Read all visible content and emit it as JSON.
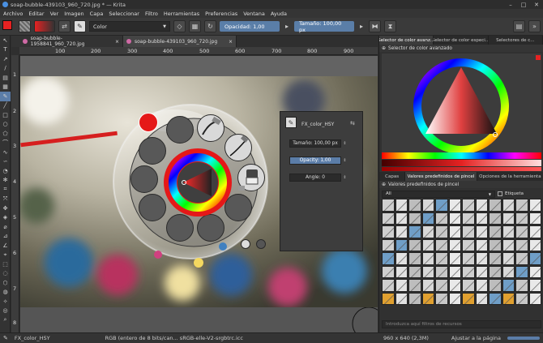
{
  "window": {
    "title": "soap-bubble-439103_960_720.jpg * — Krita",
    "min": "–",
    "max": "□",
    "close": "✕"
  },
  "menu": [
    "Archivo",
    "Editar",
    "Ver",
    "Imagen",
    "Capa",
    "Seleccionar",
    "Filtro",
    "Herramientas",
    "Preferencias",
    "Ventana",
    "Ayuda"
  ],
  "toolbar": {
    "blend_mode": "Color",
    "opacity": "Opacidad:  1,00",
    "size": "Tamaño:  100,00 px"
  },
  "tabs": [
    {
      "label": "soap-bubble-1958841_960_720.jpg"
    },
    {
      "label": "soap-bubble-439103_960_720.jpg"
    }
  ],
  "ruler": {
    "h": [
      "100",
      "200",
      "300",
      "400",
      "500",
      "600",
      "700",
      "800",
      "900"
    ],
    "v": [
      "1",
      "2",
      "3",
      "4",
      "5",
      "6",
      "7",
      "8"
    ]
  },
  "popup": {
    "preset_name": "FX_color_HSY",
    "size": "Tamaño:  100,00 px",
    "opacity": "Opacity:  1,00",
    "angle": "Angle:  0"
  },
  "right_panel": {
    "top_tabs": [
      "Selector de color avanz...",
      "Selector de color especi...",
      "Selectores de c..."
    ],
    "color_header": "Selector de color avanzado",
    "bottom_tabs": [
      "Capas",
      "Valores predefinidos de pincel",
      "Opciones de la herramienta"
    ],
    "brush_header": "Valores predefinidos de pincel",
    "filter_all": "All",
    "tag_label": "Etiqueta",
    "search_placeholder": "Introduzca aquí filtros de recursos"
  },
  "status": {
    "preset": "FX_color_HSY",
    "colorspace": "RGB (entero de 8 bits/can...  sRGB-elle-V2-srgbtrc.icc",
    "dimensions": "960 x 640 (2,3M)",
    "zoom": "Ajustar a la página"
  },
  "colors": {
    "accent": "#5b7da8",
    "fg": "#e52222",
    "panel": "#313131",
    "canvas": "#636363"
  }
}
